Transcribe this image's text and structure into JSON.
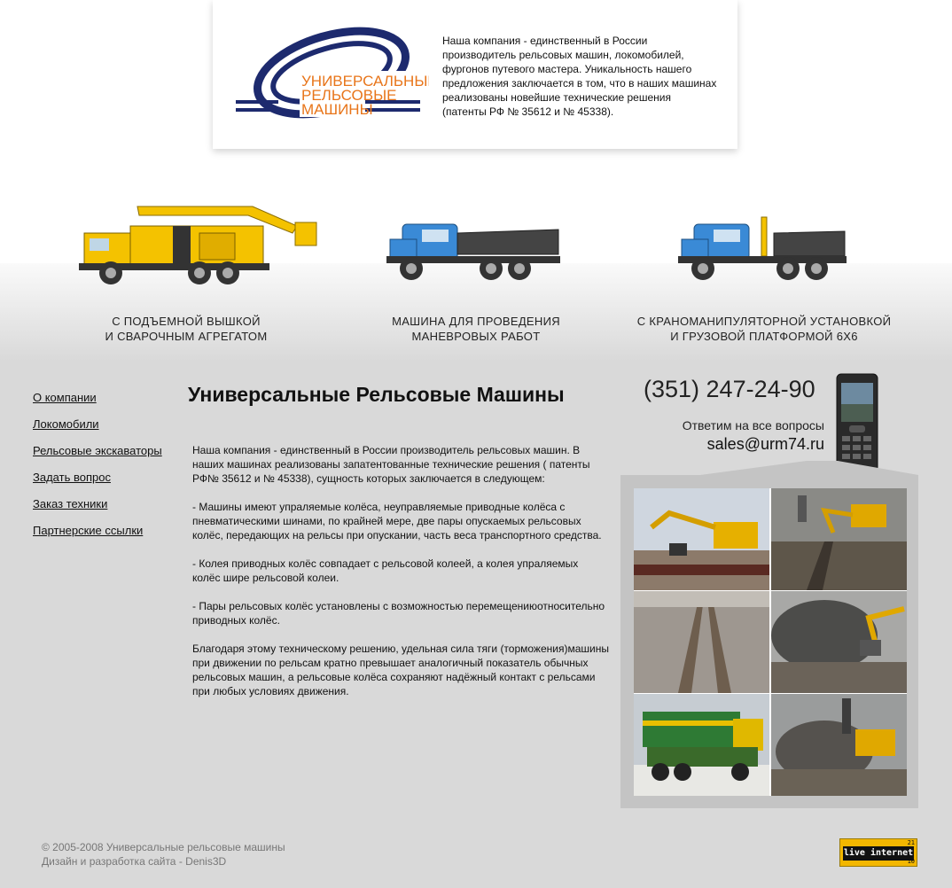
{
  "header": {
    "logo_line1": "УНИВЕРСАЛЬНЫЕ",
    "logo_line2": "РЕЛЬСОВЫЕ",
    "logo_line3": "МАШИНЫ",
    "intro": "Наша компания - единственный в России производитель рельсовых машин, локомобилей, фургонов путевого мастера. Уникальность нашего предложения заключается в том, что в наших машинах реализованы новейшие технические решения (патенты РФ № 35612 и № 45338)."
  },
  "vehicles": [
    {
      "caption": "С подъемной вышкой\nи сварочным агрегатом",
      "icon": "yellow-aerial-truck"
    },
    {
      "caption": "Машина для проведения\nманевровых работ",
      "icon": "blue-flatbed-truck"
    },
    {
      "caption": "С краноманипуляторной установкой\nи грузовой платформой 6х6",
      "icon": "blue-crane-truck"
    }
  ],
  "nav": {
    "items": [
      {
        "label": "О компании"
      },
      {
        "label": "Локомобили"
      },
      {
        "label": "Рельсовые экскаваторы"
      },
      {
        "label": "Задать вопрос"
      },
      {
        "label": "Заказ техники"
      },
      {
        "label": "Партнерские ссылки"
      }
    ]
  },
  "main": {
    "title": "Универсальные Рельсовые Машины",
    "paragraphs": [
      "Наша компания - единственный в России производитель рельсовых машин. В наших машинах реализованы запатентованные технические решения ( патенты РФ№ 35612 и № 45338), сущность которых заключается в следующем:",
      "- Машины имеют упраляемые колёса, неуправляемые приводные колёса с пневматическими шинами, по крайней мере, две пары опускаемых рельсовых колёс, передающих на рельсы при опускании, часть веса транспортного средства.",
      "- Колея приводных колёс совпадает с рельсовой колеей, а колея упраляемых колёс шире рельсовой колеи.",
      "- Пары рельсовых колёс установлены с возможностью перемещениюотносительно приводных колёс.",
      "Благодаря этому техническому решению, удельная сила тяги (торможения)машины при движении по рельсам кратно превышает аналогичный показатель обычных рельсовых машин, а рельсовые колёса сохраняют надёжный контакт с рельсами при любых условиях движения."
    ]
  },
  "contact": {
    "phone": "(351) 247-24-90",
    "answer": "Ответим на все вопросы",
    "email": "sales@urm74.ru"
  },
  "photos": [
    {
      "icon": "excavator-on-platform-photo"
    },
    {
      "icon": "excavator-on-track-photo"
    },
    {
      "icon": "railway-track-photo"
    },
    {
      "icon": "excavator-bucket-smoke-photo"
    },
    {
      "icon": "green-rail-truck-photo"
    },
    {
      "icon": "excavator-smoke-photo"
    }
  ],
  "footer": {
    "copyright": "© 2005-2008 Универсальные рельсовые машины",
    "design": "Дизайн и разработка сайта - Denis3D"
  },
  "counter": {
    "label": "live internet",
    "num1": "21",
    "num2": "10"
  },
  "colors": {
    "logo_blue": "#1d2a6e",
    "logo_orange": "#e8751a",
    "truck_yellow": "#f4c200",
    "truck_blue": "#3a8ad6",
    "background_gray": "#d9d9d9",
    "counter_yellow": "#f3b700"
  }
}
